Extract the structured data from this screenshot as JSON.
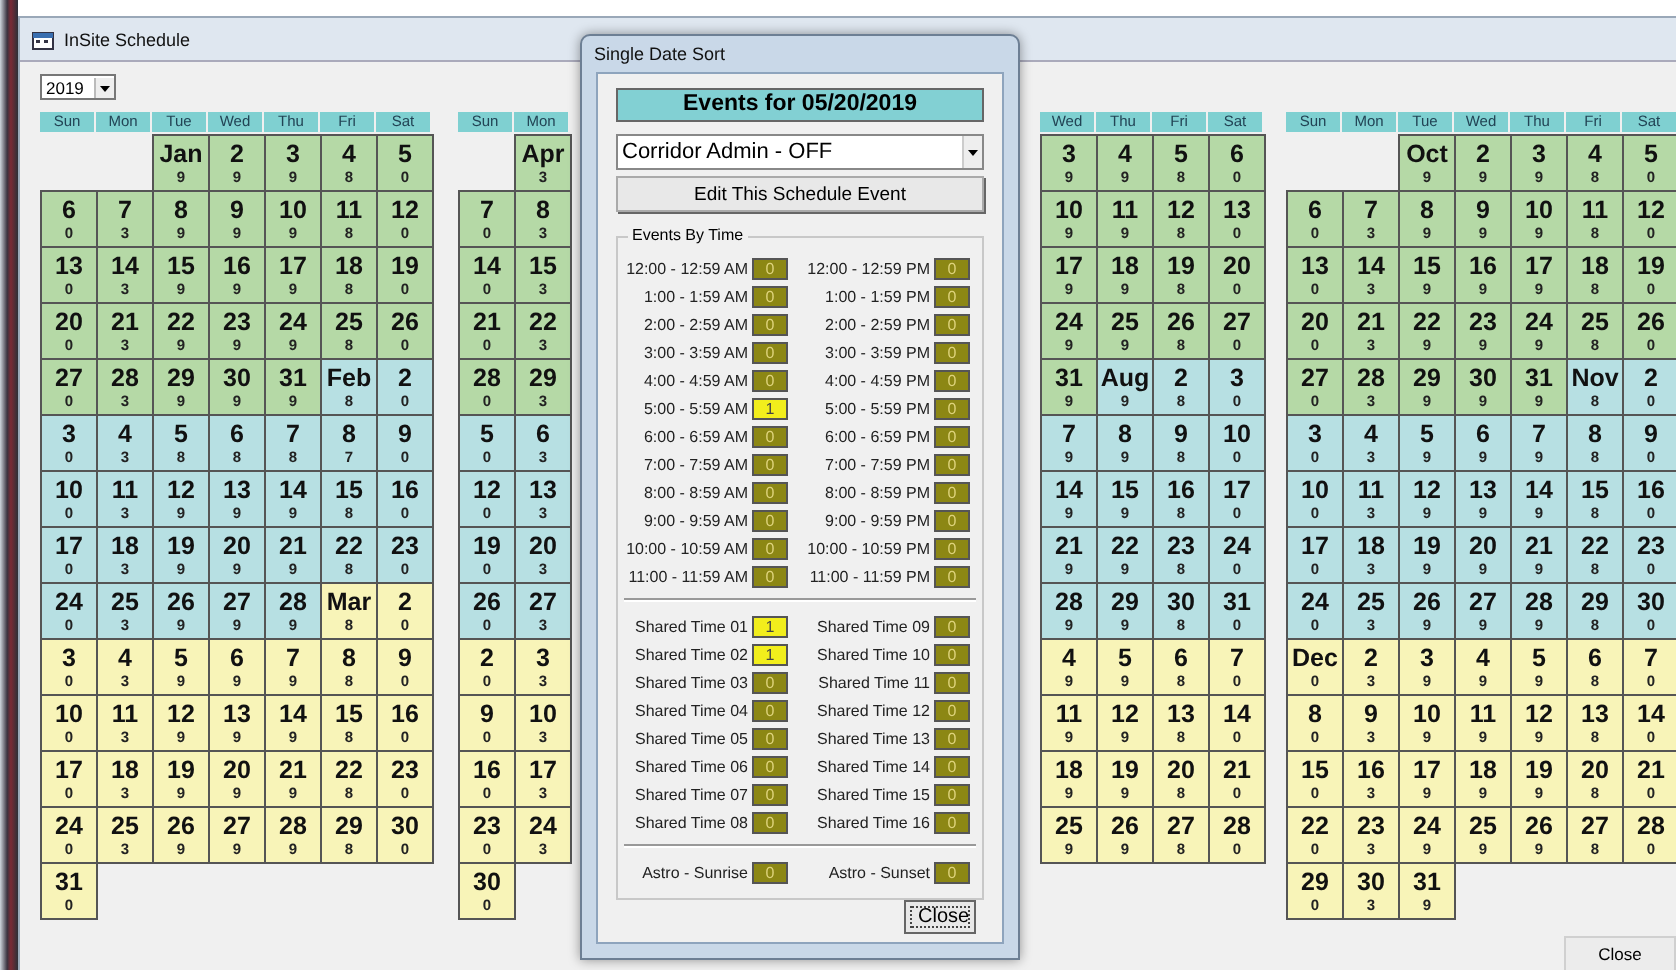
{
  "window": {
    "title": "InSite Schedule"
  },
  "year_select": {
    "value": "2019"
  },
  "quarters": [
    {
      "weekdays": [
        "Sun",
        "Mon",
        "Tue",
        "Wed",
        "Thu",
        "Fri",
        "Sat"
      ],
      "weeks": [
        [
          {
            "day": "Jan",
            "count": "9",
            "color": "#b5d9a6"
          },
          {
            "day": "2",
            "count": "9",
            "color": "#b5d9a6"
          },
          {
            "day": "3",
            "count": "9",
            "color": "#b5d9a6"
          },
          {
            "day": "4",
            "count": "8",
            "color": "#b5d9a6"
          },
          {
            "day": "5",
            "count": "0",
            "color": "#b5d9a6"
          }
        ],
        [
          {
            "day": "6",
            "count": "0",
            "color": "#b5d9a6"
          },
          {
            "day": "7",
            "count": "3",
            "color": "#b5d9a6"
          },
          {
            "day": "8",
            "count": "9",
            "color": "#b5d9a6"
          },
          {
            "day": "9",
            "count": "9",
            "color": "#b5d9a6"
          },
          {
            "day": "10",
            "count": "9",
            "color": "#b5d9a6"
          },
          {
            "day": "11",
            "count": "8",
            "color": "#b5d9a6"
          },
          {
            "day": "12",
            "count": "0",
            "color": "#b5d9a6"
          }
        ],
        [
          {
            "day": "13",
            "count": "0",
            "color": "#b5d9a6"
          },
          {
            "day": "14",
            "count": "3",
            "color": "#b5d9a6"
          },
          {
            "day": "15",
            "count": "9",
            "color": "#b5d9a6"
          },
          {
            "day": "16",
            "count": "9",
            "color": "#b5d9a6"
          },
          {
            "day": "17",
            "count": "9",
            "color": "#b5d9a6"
          },
          {
            "day": "18",
            "count": "8",
            "color": "#b5d9a6"
          },
          {
            "day": "19",
            "count": "0",
            "color": "#b5d9a6"
          }
        ],
        [
          {
            "day": "20",
            "count": "0",
            "color": "#b5d9a6"
          },
          {
            "day": "21",
            "count": "3",
            "color": "#b5d9a6"
          },
          {
            "day": "22",
            "count": "9",
            "color": "#b5d9a6"
          },
          {
            "day": "23",
            "count": "9",
            "color": "#b5d9a6"
          },
          {
            "day": "24",
            "count": "9",
            "color": "#b5d9a6"
          },
          {
            "day": "25",
            "count": "8",
            "color": "#b5d9a6"
          },
          {
            "day": "26",
            "count": "0",
            "color": "#b5d9a6"
          }
        ],
        [
          {
            "day": "27",
            "count": "0",
            "color": "#b5d9a6"
          },
          {
            "day": "28",
            "count": "3",
            "color": "#b5d9a6"
          },
          {
            "day": "29",
            "count": "9",
            "color": "#b5d9a6"
          },
          {
            "day": "30",
            "count": "9",
            "color": "#b5d9a6"
          },
          {
            "day": "31",
            "count": "9",
            "color": "#b5d9a6"
          },
          {
            "day": "Feb",
            "count": "8",
            "color": "#b7e0e3"
          },
          {
            "day": "2",
            "count": "0",
            "color": "#b7e0e3"
          }
        ],
        [
          {
            "day": "3",
            "count": "0",
            "color": "#b7e0e3"
          },
          {
            "day": "4",
            "count": "3",
            "color": "#b7e0e3"
          },
          {
            "day": "5",
            "count": "8",
            "color": "#b7e0e3"
          },
          {
            "day": "6",
            "count": "8",
            "color": "#b7e0e3"
          },
          {
            "day": "7",
            "count": "8",
            "color": "#b7e0e3"
          },
          {
            "day": "8",
            "count": "7",
            "color": "#b7e0e3"
          },
          {
            "day": "9",
            "count": "0",
            "color": "#b7e0e3"
          }
        ],
        [
          {
            "day": "10",
            "count": "0",
            "color": "#b7e0e3"
          },
          {
            "day": "11",
            "count": "3",
            "color": "#b7e0e3"
          },
          {
            "day": "12",
            "count": "9",
            "color": "#b7e0e3"
          },
          {
            "day": "13",
            "count": "9",
            "color": "#b7e0e3"
          },
          {
            "day": "14",
            "count": "9",
            "color": "#b7e0e3"
          },
          {
            "day": "15",
            "count": "8",
            "color": "#b7e0e3"
          },
          {
            "day": "16",
            "count": "0",
            "color": "#b7e0e3"
          }
        ],
        [
          {
            "day": "17",
            "count": "0",
            "color": "#b7e0e3"
          },
          {
            "day": "18",
            "count": "3",
            "color": "#b7e0e3"
          },
          {
            "day": "19",
            "count": "9",
            "color": "#b7e0e3"
          },
          {
            "day": "20",
            "count": "9",
            "color": "#b7e0e3"
          },
          {
            "day": "21",
            "count": "9",
            "color": "#b7e0e3"
          },
          {
            "day": "22",
            "count": "8",
            "color": "#b7e0e3"
          },
          {
            "day": "23",
            "count": "0",
            "color": "#b7e0e3"
          }
        ],
        [
          {
            "day": "24",
            "count": "0",
            "color": "#b7e0e3"
          },
          {
            "day": "25",
            "count": "3",
            "color": "#b7e0e3"
          },
          {
            "day": "26",
            "count": "9",
            "color": "#b7e0e3"
          },
          {
            "day": "27",
            "count": "9",
            "color": "#b7e0e3"
          },
          {
            "day": "28",
            "count": "9",
            "color": "#b7e0e3"
          },
          {
            "day": "Mar",
            "count": "8",
            "color": "#f8f4b8"
          },
          {
            "day": "2",
            "count": "0",
            "color": "#f8f4b8"
          }
        ],
        [
          {
            "day": "3",
            "count": "0",
            "color": "#f8f4b8"
          },
          {
            "day": "4",
            "count": "3",
            "color": "#f8f4b8"
          },
          {
            "day": "5",
            "count": "9",
            "color": "#f8f4b8"
          },
          {
            "day": "6",
            "count": "9",
            "color": "#f8f4b8"
          },
          {
            "day": "7",
            "count": "9",
            "color": "#f8f4b8"
          },
          {
            "day": "8",
            "count": "8",
            "color": "#f8f4b8"
          },
          {
            "day": "9",
            "count": "0",
            "color": "#f8f4b8"
          }
        ],
        [
          {
            "day": "10",
            "count": "0",
            "color": "#f8f4b8"
          },
          {
            "day": "11",
            "count": "3",
            "color": "#f8f4b8"
          },
          {
            "day": "12",
            "count": "9",
            "color": "#f8f4b8"
          },
          {
            "day": "13",
            "count": "9",
            "color": "#f8f4b8"
          },
          {
            "day": "14",
            "count": "9",
            "color": "#f8f4b8"
          },
          {
            "day": "15",
            "count": "8",
            "color": "#f8f4b8"
          },
          {
            "day": "16",
            "count": "0",
            "color": "#f8f4b8"
          }
        ],
        [
          {
            "day": "17",
            "count": "0",
            "color": "#f8f4b8"
          },
          {
            "day": "18",
            "count": "3",
            "color": "#f8f4b8"
          },
          {
            "day": "19",
            "count": "9",
            "color": "#f8f4b8"
          },
          {
            "day": "20",
            "count": "9",
            "color": "#f8f4b8"
          },
          {
            "day": "21",
            "count": "9",
            "color": "#f8f4b8"
          },
          {
            "day": "22",
            "count": "8",
            "color": "#f8f4b8"
          },
          {
            "day": "23",
            "count": "0",
            "color": "#f8f4b8"
          }
        ],
        [
          {
            "day": "24",
            "count": "0",
            "color": "#f8f4b8"
          },
          {
            "day": "25",
            "count": "3",
            "color": "#f8f4b8"
          },
          {
            "day": "26",
            "count": "9",
            "color": "#f8f4b8"
          },
          {
            "day": "27",
            "count": "9",
            "color": "#f8f4b8"
          },
          {
            "day": "28",
            "count": "9",
            "color": "#f8f4b8"
          },
          {
            "day": "29",
            "count": "8",
            "color": "#f8f4b8"
          },
          {
            "day": "30",
            "count": "0",
            "color": "#f8f4b8"
          }
        ],
        [
          {
            "day": "31",
            "count": "0",
            "color": "#f8f4b8"
          }
        ]
      ]
    },
    {
      "weekdays": [
        "Sun",
        "Mon"
      ],
      "weeks": [
        [
          {
            "day": "Apr",
            "count": "3",
            "color": "#b5d9a6"
          }
        ],
        [
          {
            "day": "7",
            "count": "0",
            "color": "#b5d9a6"
          },
          {
            "day": "8",
            "count": "3",
            "color": "#b5d9a6"
          }
        ],
        [
          {
            "day": "14",
            "count": "0",
            "color": "#b5d9a6"
          },
          {
            "day": "15",
            "count": "3",
            "color": "#b5d9a6"
          }
        ],
        [
          {
            "day": "21",
            "count": "0",
            "color": "#b5d9a6"
          },
          {
            "day": "22",
            "count": "3",
            "color": "#b5d9a6"
          }
        ],
        [
          {
            "day": "28",
            "count": "0",
            "color": "#b5d9a6"
          },
          {
            "day": "29",
            "count": "3",
            "color": "#b5d9a6"
          }
        ],
        [
          {
            "day": "5",
            "count": "0",
            "color": "#b7e0e3"
          },
          {
            "day": "6",
            "count": "3",
            "color": "#b7e0e3"
          }
        ],
        [
          {
            "day": "12",
            "count": "0",
            "color": "#b7e0e3"
          },
          {
            "day": "13",
            "count": "3",
            "color": "#b7e0e3"
          }
        ],
        [
          {
            "day": "19",
            "count": "0",
            "color": "#b7e0e3"
          },
          {
            "day": "20",
            "count": "3",
            "color": "#b7e0e3"
          }
        ],
        [
          {
            "day": "26",
            "count": "0",
            "color": "#b7e0e3"
          },
          {
            "day": "27",
            "count": "3",
            "color": "#b7e0e3"
          }
        ],
        [
          {
            "day": "2",
            "count": "0",
            "color": "#f8f4b8"
          },
          {
            "day": "3",
            "count": "3",
            "color": "#f8f4b8"
          }
        ],
        [
          {
            "day": "9",
            "count": "0",
            "color": "#f8f4b8"
          },
          {
            "day": "10",
            "count": "3",
            "color": "#f8f4b8"
          }
        ],
        [
          {
            "day": "16",
            "count": "0",
            "color": "#f8f4b8"
          },
          {
            "day": "17",
            "count": "3",
            "color": "#f8f4b8"
          }
        ],
        [
          {
            "day": "23",
            "count": "0",
            "color": "#f8f4b8"
          },
          {
            "day": "24",
            "count": "3",
            "color": "#f8f4b8"
          }
        ],
        [
          {
            "day": "30",
            "count": "0",
            "color": "#f8f4b8"
          }
        ]
      ]
    },
    {
      "weekdays": [
        "Wed",
        "Thu",
        "Fri",
        "Sat"
      ],
      "weeks": [
        [
          {
            "day": "3",
            "count": "9",
            "color": "#b5d9a6"
          },
          {
            "day": "4",
            "count": "9",
            "color": "#b5d9a6"
          },
          {
            "day": "5",
            "count": "8",
            "color": "#b5d9a6"
          },
          {
            "day": "6",
            "count": "0",
            "color": "#b5d9a6"
          }
        ],
        [
          {
            "day": "10",
            "count": "9",
            "color": "#b5d9a6"
          },
          {
            "day": "11",
            "count": "9",
            "color": "#b5d9a6"
          },
          {
            "day": "12",
            "count": "8",
            "color": "#b5d9a6"
          },
          {
            "day": "13",
            "count": "0",
            "color": "#b5d9a6"
          }
        ],
        [
          {
            "day": "17",
            "count": "9",
            "color": "#b5d9a6"
          },
          {
            "day": "18",
            "count": "9",
            "color": "#b5d9a6"
          },
          {
            "day": "19",
            "count": "8",
            "color": "#b5d9a6"
          },
          {
            "day": "20",
            "count": "0",
            "color": "#b5d9a6"
          }
        ],
        [
          {
            "day": "24",
            "count": "9",
            "color": "#b5d9a6"
          },
          {
            "day": "25",
            "count": "9",
            "color": "#b5d9a6"
          },
          {
            "day": "26",
            "count": "8",
            "color": "#b5d9a6"
          },
          {
            "day": "27",
            "count": "0",
            "color": "#b5d9a6"
          }
        ],
        [
          {
            "day": "31",
            "count": "9",
            "color": "#b5d9a6"
          },
          {
            "day": "Aug",
            "count": "9",
            "color": "#b7e0e3"
          },
          {
            "day": "2",
            "count": "8",
            "color": "#b7e0e3"
          },
          {
            "day": "3",
            "count": "0",
            "color": "#b7e0e3"
          }
        ],
        [
          {
            "day": "7",
            "count": "9",
            "color": "#b7e0e3"
          },
          {
            "day": "8",
            "count": "9",
            "color": "#b7e0e3"
          },
          {
            "day": "9",
            "count": "8",
            "color": "#b7e0e3"
          },
          {
            "day": "10",
            "count": "0",
            "color": "#b7e0e3"
          }
        ],
        [
          {
            "day": "14",
            "count": "9",
            "color": "#b7e0e3"
          },
          {
            "day": "15",
            "count": "9",
            "color": "#b7e0e3"
          },
          {
            "day": "16",
            "count": "8",
            "color": "#b7e0e3"
          },
          {
            "day": "17",
            "count": "0",
            "color": "#b7e0e3"
          }
        ],
        [
          {
            "day": "21",
            "count": "9",
            "color": "#b7e0e3"
          },
          {
            "day": "22",
            "count": "9",
            "color": "#b7e0e3"
          },
          {
            "day": "23",
            "count": "8",
            "color": "#b7e0e3"
          },
          {
            "day": "24",
            "count": "0",
            "color": "#b7e0e3"
          }
        ],
        [
          {
            "day": "28",
            "count": "9",
            "color": "#b7e0e3"
          },
          {
            "day": "29",
            "count": "9",
            "color": "#b7e0e3"
          },
          {
            "day": "30",
            "count": "8",
            "color": "#b7e0e3"
          },
          {
            "day": "31",
            "count": "0",
            "color": "#b7e0e3"
          }
        ],
        [
          {
            "day": "4",
            "count": "9",
            "color": "#f8f4b8"
          },
          {
            "day": "5",
            "count": "9",
            "color": "#f8f4b8"
          },
          {
            "day": "6",
            "count": "8",
            "color": "#f8f4b8"
          },
          {
            "day": "7",
            "count": "0",
            "color": "#f8f4b8"
          }
        ],
        [
          {
            "day": "11",
            "count": "9",
            "color": "#f8f4b8"
          },
          {
            "day": "12",
            "count": "9",
            "color": "#f8f4b8"
          },
          {
            "day": "13",
            "count": "8",
            "color": "#f8f4b8"
          },
          {
            "day": "14",
            "count": "0",
            "color": "#f8f4b8"
          }
        ],
        [
          {
            "day": "18",
            "count": "9",
            "color": "#f8f4b8"
          },
          {
            "day": "19",
            "count": "9",
            "color": "#f8f4b8"
          },
          {
            "day": "20",
            "count": "8",
            "color": "#f8f4b8"
          },
          {
            "day": "21",
            "count": "0",
            "color": "#f8f4b8"
          }
        ],
        [
          {
            "day": "25",
            "count": "9",
            "color": "#f8f4b8"
          },
          {
            "day": "26",
            "count": "9",
            "color": "#f8f4b8"
          },
          {
            "day": "27",
            "count": "8",
            "color": "#f8f4b8"
          },
          {
            "day": "28",
            "count": "0",
            "color": "#f8f4b8"
          }
        ]
      ]
    },
    {
      "weekdays": [
        "Sun",
        "Mon",
        "Tue",
        "Wed",
        "Thu",
        "Fri",
        "Sat"
      ],
      "weeks": [
        [
          {
            "day": "Oct",
            "count": "9",
            "color": "#b5d9a6"
          },
          {
            "day": "2",
            "count": "9",
            "color": "#b5d9a6"
          },
          {
            "day": "3",
            "count": "9",
            "color": "#b5d9a6"
          },
          {
            "day": "4",
            "count": "8",
            "color": "#b5d9a6"
          },
          {
            "day": "5",
            "count": "0",
            "color": "#b5d9a6"
          }
        ],
        [
          {
            "day": "6",
            "count": "0",
            "color": "#b5d9a6"
          },
          {
            "day": "7",
            "count": "3",
            "color": "#b5d9a6"
          },
          {
            "day": "8",
            "count": "9",
            "color": "#b5d9a6"
          },
          {
            "day": "9",
            "count": "9",
            "color": "#b5d9a6"
          },
          {
            "day": "10",
            "count": "9",
            "color": "#b5d9a6"
          },
          {
            "day": "11",
            "count": "8",
            "color": "#b5d9a6"
          },
          {
            "day": "12",
            "count": "0",
            "color": "#b5d9a6"
          }
        ],
        [
          {
            "day": "13",
            "count": "0",
            "color": "#b5d9a6"
          },
          {
            "day": "14",
            "count": "3",
            "color": "#b5d9a6"
          },
          {
            "day": "15",
            "count": "9",
            "color": "#b5d9a6"
          },
          {
            "day": "16",
            "count": "9",
            "color": "#b5d9a6"
          },
          {
            "day": "17",
            "count": "9",
            "color": "#b5d9a6"
          },
          {
            "day": "18",
            "count": "8",
            "color": "#b5d9a6"
          },
          {
            "day": "19",
            "count": "0",
            "color": "#b5d9a6"
          }
        ],
        [
          {
            "day": "20",
            "count": "0",
            "color": "#b5d9a6"
          },
          {
            "day": "21",
            "count": "3",
            "color": "#b5d9a6"
          },
          {
            "day": "22",
            "count": "9",
            "color": "#b5d9a6"
          },
          {
            "day": "23",
            "count": "9",
            "color": "#b5d9a6"
          },
          {
            "day": "24",
            "count": "9",
            "color": "#b5d9a6"
          },
          {
            "day": "25",
            "count": "8",
            "color": "#b5d9a6"
          },
          {
            "day": "26",
            "count": "0",
            "color": "#b5d9a6"
          }
        ],
        [
          {
            "day": "27",
            "count": "0",
            "color": "#b5d9a6"
          },
          {
            "day": "28",
            "count": "3",
            "color": "#b5d9a6"
          },
          {
            "day": "29",
            "count": "9",
            "color": "#b5d9a6"
          },
          {
            "day": "30",
            "count": "9",
            "color": "#b5d9a6"
          },
          {
            "day": "31",
            "count": "9",
            "color": "#b5d9a6"
          },
          {
            "day": "Nov",
            "count": "8",
            "color": "#b7e0e3"
          },
          {
            "day": "2",
            "count": "0",
            "color": "#b7e0e3"
          }
        ],
        [
          {
            "day": "3",
            "count": "0",
            "color": "#b7e0e3"
          },
          {
            "day": "4",
            "count": "3",
            "color": "#b7e0e3"
          },
          {
            "day": "5",
            "count": "9",
            "color": "#b7e0e3"
          },
          {
            "day": "6",
            "count": "9",
            "color": "#b7e0e3"
          },
          {
            "day": "7",
            "count": "9",
            "color": "#b7e0e3"
          },
          {
            "day": "8",
            "count": "8",
            "color": "#b7e0e3"
          },
          {
            "day": "9",
            "count": "0",
            "color": "#b7e0e3"
          }
        ],
        [
          {
            "day": "10",
            "count": "0",
            "color": "#b7e0e3"
          },
          {
            "day": "11",
            "count": "3",
            "color": "#b7e0e3"
          },
          {
            "day": "12",
            "count": "9",
            "color": "#b7e0e3"
          },
          {
            "day": "13",
            "count": "9",
            "color": "#b7e0e3"
          },
          {
            "day": "14",
            "count": "9",
            "color": "#b7e0e3"
          },
          {
            "day": "15",
            "count": "8",
            "color": "#b7e0e3"
          },
          {
            "day": "16",
            "count": "0",
            "color": "#b7e0e3"
          }
        ],
        [
          {
            "day": "17",
            "count": "0",
            "color": "#b7e0e3"
          },
          {
            "day": "18",
            "count": "3",
            "color": "#b7e0e3"
          },
          {
            "day": "19",
            "count": "9",
            "color": "#b7e0e3"
          },
          {
            "day": "20",
            "count": "9",
            "color": "#b7e0e3"
          },
          {
            "day": "21",
            "count": "9",
            "color": "#b7e0e3"
          },
          {
            "day": "22",
            "count": "8",
            "color": "#b7e0e3"
          },
          {
            "day": "23",
            "count": "0",
            "color": "#b7e0e3"
          }
        ],
        [
          {
            "day": "24",
            "count": "0",
            "color": "#b7e0e3"
          },
          {
            "day": "25",
            "count": "3",
            "color": "#b7e0e3"
          },
          {
            "day": "26",
            "count": "9",
            "color": "#b7e0e3"
          },
          {
            "day": "27",
            "count": "9",
            "color": "#b7e0e3"
          },
          {
            "day": "28",
            "count": "9",
            "color": "#b7e0e3"
          },
          {
            "day": "29",
            "count": "8",
            "color": "#b7e0e3"
          },
          {
            "day": "30",
            "count": "0",
            "color": "#b7e0e3"
          }
        ],
        [
          {
            "day": "Dec",
            "count": "0",
            "color": "#f8f4b8"
          },
          {
            "day": "2",
            "count": "3",
            "color": "#f8f4b8"
          },
          {
            "day": "3",
            "count": "9",
            "color": "#f8f4b8"
          },
          {
            "day": "4",
            "count": "9",
            "color": "#f8f4b8"
          },
          {
            "day": "5",
            "count": "9",
            "color": "#f8f4b8"
          },
          {
            "day": "6",
            "count": "8",
            "color": "#f8f4b8"
          },
          {
            "day": "7",
            "count": "0",
            "color": "#f8f4b8"
          }
        ],
        [
          {
            "day": "8",
            "count": "0",
            "color": "#f8f4b8"
          },
          {
            "day": "9",
            "count": "3",
            "color": "#f8f4b8"
          },
          {
            "day": "10",
            "count": "9",
            "color": "#f8f4b8"
          },
          {
            "day": "11",
            "count": "9",
            "color": "#f8f4b8"
          },
          {
            "day": "12",
            "count": "9",
            "color": "#f8f4b8"
          },
          {
            "day": "13",
            "count": "8",
            "color": "#f8f4b8"
          },
          {
            "day": "14",
            "count": "0",
            "color": "#f8f4b8"
          }
        ],
        [
          {
            "day": "15",
            "count": "0",
            "color": "#f8f4b8"
          },
          {
            "day": "16",
            "count": "3",
            "color": "#f8f4b8"
          },
          {
            "day": "17",
            "count": "9",
            "color": "#f8f4b8"
          },
          {
            "day": "18",
            "count": "9",
            "color": "#f8f4b8"
          },
          {
            "day": "19",
            "count": "9",
            "color": "#f8f4b8"
          },
          {
            "day": "20",
            "count": "8",
            "color": "#f8f4b8"
          },
          {
            "day": "21",
            "count": "0",
            "color": "#f8f4b8"
          }
        ],
        [
          {
            "day": "22",
            "count": "0",
            "color": "#f8f4b8"
          },
          {
            "day": "23",
            "count": "3",
            "color": "#f8f4b8"
          },
          {
            "day": "24",
            "count": "9",
            "color": "#f8f4b8"
          },
          {
            "day": "25",
            "count": "9",
            "color": "#f8f4b8"
          },
          {
            "day": "26",
            "count": "9",
            "color": "#f8f4b8"
          },
          {
            "day": "27",
            "count": "8",
            "color": "#f8f4b8"
          },
          {
            "day": "28",
            "count": "0",
            "color": "#f8f4b8"
          }
        ],
        [
          {
            "day": "29",
            "count": "0",
            "color": "#f8f4b8"
          },
          {
            "day": "30",
            "count": "3",
            "color": "#f8f4b8"
          },
          {
            "day": "31",
            "count": "9",
            "color": "#f8f4b8"
          }
        ]
      ]
    }
  ],
  "close_button": "Close",
  "dialog": {
    "title": "Single Date Sort",
    "heading": "Events for 05/20/2019",
    "event_select": {
      "value": "Corridor Admin - OFF"
    },
    "edit_button": "Edit This Schedule Event",
    "group_title": "Events By Time",
    "time_slots": [
      {
        "label": "12:00 - 12:59 AM",
        "count": "0",
        "highlighted": false
      },
      {
        "label": "12:00 - 12:59 PM",
        "count": "0",
        "highlighted": false
      },
      {
        "label": "1:00 - 1:59 AM",
        "count": "0",
        "highlighted": false
      },
      {
        "label": "1:00 - 1:59 PM",
        "count": "0",
        "highlighted": false
      },
      {
        "label": "2:00 - 2:59 AM",
        "count": "0",
        "highlighted": false
      },
      {
        "label": "2:00 - 2:59 PM",
        "count": "0",
        "highlighted": false
      },
      {
        "label": "3:00 - 3:59 AM",
        "count": "0",
        "highlighted": false
      },
      {
        "label": "3:00 - 3:59 PM",
        "count": "0",
        "highlighted": false
      },
      {
        "label": "4:00 - 4:59 AM",
        "count": "0",
        "highlighted": false
      },
      {
        "label": "4:00 - 4:59 PM",
        "count": "0",
        "highlighted": false
      },
      {
        "label": "5:00 - 5:59 AM",
        "count": "1",
        "highlighted": true
      },
      {
        "label": "5:00 - 5:59 PM",
        "count": "0",
        "highlighted": false
      },
      {
        "label": "6:00 - 6:59 AM",
        "count": "0",
        "highlighted": false
      },
      {
        "label": "6:00 - 6:59 PM",
        "count": "0",
        "highlighted": false
      },
      {
        "label": "7:00 - 7:59 AM",
        "count": "0",
        "highlighted": false
      },
      {
        "label": "7:00 - 7:59 PM",
        "count": "0",
        "highlighted": false
      },
      {
        "label": "8:00 - 8:59 AM",
        "count": "0",
        "highlighted": false
      },
      {
        "label": "8:00 - 8:59 PM",
        "count": "0",
        "highlighted": false
      },
      {
        "label": "9:00 - 9:59 AM",
        "count": "0",
        "highlighted": false
      },
      {
        "label": "9:00 - 9:59 PM",
        "count": "0",
        "highlighted": false
      },
      {
        "label": "10:00 - 10:59 AM",
        "count": "0",
        "highlighted": false
      },
      {
        "label": "10:00 - 10:59 PM",
        "count": "0",
        "highlighted": false
      },
      {
        "label": "11:00 - 11:59 AM",
        "count": "0",
        "highlighted": false
      },
      {
        "label": "11:00 - 11:59 PM",
        "count": "0",
        "highlighted": false
      }
    ],
    "shared_times": [
      {
        "label": "Shared Time 01",
        "count": "1",
        "highlighted": true
      },
      {
        "label": "Shared Time 09",
        "count": "0",
        "highlighted": false
      },
      {
        "label": "Shared Time 02",
        "count": "1",
        "highlighted": true
      },
      {
        "label": "Shared Time 10",
        "count": "0",
        "highlighted": false
      },
      {
        "label": "Shared Time 03",
        "count": "0",
        "highlighted": false
      },
      {
        "label": "Shared Time 11",
        "count": "0",
        "highlighted": false
      },
      {
        "label": "Shared Time 04",
        "count": "0",
        "highlighted": false
      },
      {
        "label": "Shared Time 12",
        "count": "0",
        "highlighted": false
      },
      {
        "label": "Shared Time 05",
        "count": "0",
        "highlighted": false
      },
      {
        "label": "Shared Time 13",
        "count": "0",
        "highlighted": false
      },
      {
        "label": "Shared Time 06",
        "count": "0",
        "highlighted": false
      },
      {
        "label": "Shared Time 14",
        "count": "0",
        "highlighted": false
      },
      {
        "label": "Shared Time 07",
        "count": "0",
        "highlighted": false
      },
      {
        "label": "Shared Time 15",
        "count": "0",
        "highlighted": false
      },
      {
        "label": "Shared Time 08",
        "count": "0",
        "highlighted": false
      },
      {
        "label": "Shared Time 16",
        "count": "0",
        "highlighted": false
      }
    ],
    "astro": [
      {
        "label": "Astro - Sunrise",
        "count": "0",
        "highlighted": false
      },
      {
        "label": "Astro - Sunset",
        "count": "0",
        "highlighted": false
      }
    ],
    "close_button": "Close"
  }
}
